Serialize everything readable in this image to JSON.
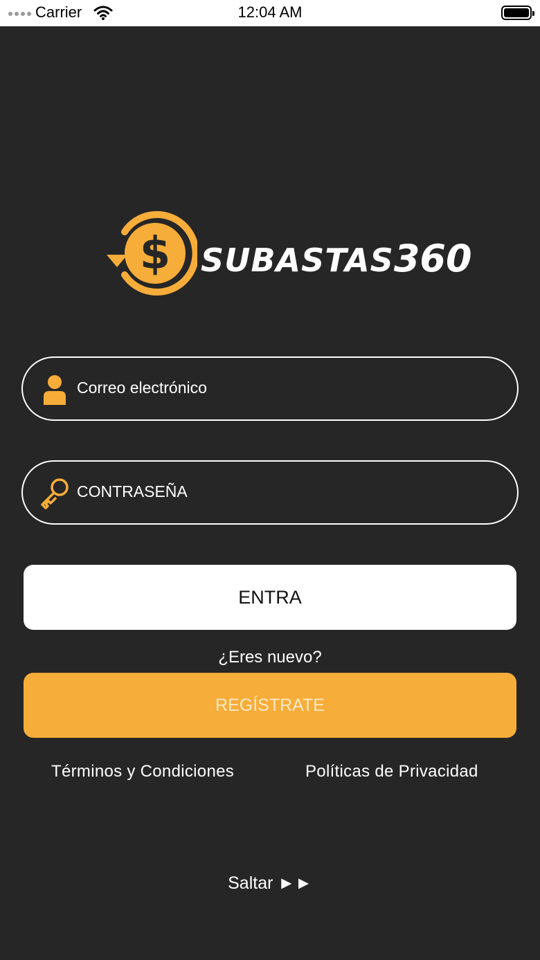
{
  "status_bar": {
    "carrier": "Carrier",
    "time": "12:04 AM"
  },
  "logo": {
    "brand_text": "SUBASTAS",
    "brand_number": "360",
    "icon": "dollar-refresh-icon",
    "accent_color": "#f7ad39"
  },
  "form": {
    "email_placeholder": "Correo electrónico",
    "email_icon": "user-icon",
    "password_placeholder": "CONTRASEÑA",
    "password_icon": "key-icon",
    "login_label": "ENTRA",
    "new_user_prompt": "¿Eres nuevo?",
    "register_label": "REGÍSTRATE"
  },
  "links": {
    "terms": "Términos y Condiciones",
    "privacy": "Políticas de Privacidad",
    "skip": "Saltar ►►"
  },
  "colors": {
    "background": "#262626",
    "accent": "#f7ad39"
  }
}
